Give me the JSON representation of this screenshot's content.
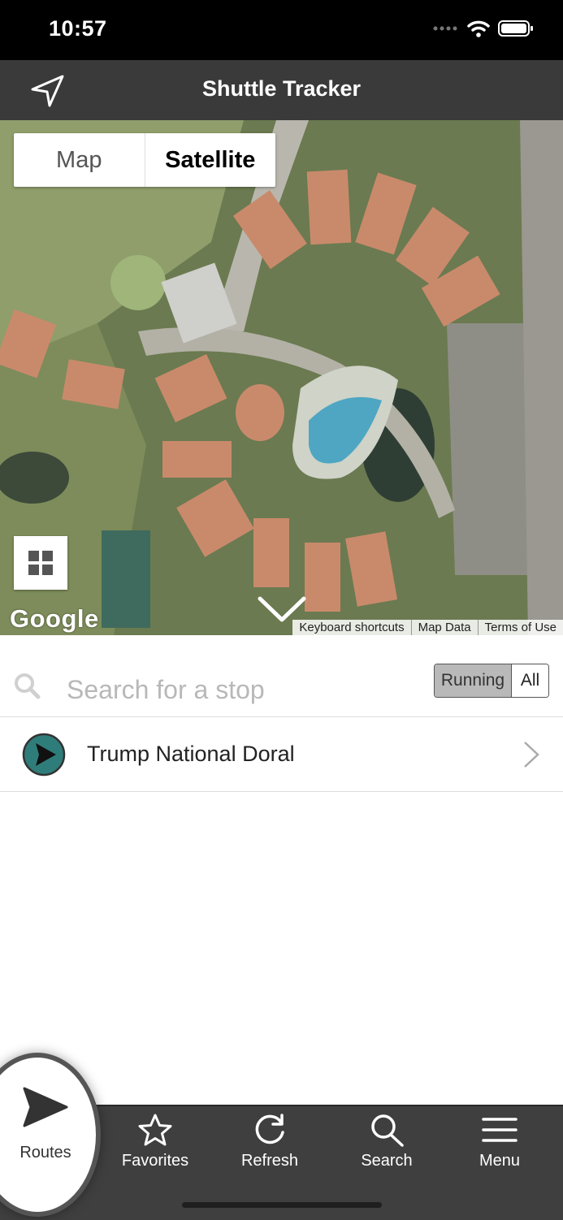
{
  "status_bar": {
    "time": "10:57",
    "signal_icon": "signal-dots-icon",
    "wifi_icon": "wifi-icon",
    "battery_icon": "battery-icon"
  },
  "nav": {
    "title": "Shuttle Tracker",
    "left_icon": "location-arrow-icon"
  },
  "map": {
    "type_toggle": {
      "map_label": "Map",
      "satellite_label": "Satellite",
      "selected": "Satellite"
    },
    "layers_icon": "grid-icon",
    "logo": "Google",
    "footer": {
      "keyboard": "Keyboard shortcuts",
      "data": "Map Data",
      "terms": "Terms of Use"
    },
    "collapse_icon": "chevron-down-icon"
  },
  "search": {
    "placeholder": "Search for a stop",
    "value": "",
    "icon": "search-icon"
  },
  "filter": {
    "running_label": "Running",
    "all_label": "All",
    "selected": "Running"
  },
  "routes": [
    {
      "name": "Trump National Doral",
      "color": "#2f7d7a",
      "icon": "play-circle-icon"
    }
  ],
  "tabs": {
    "routes": {
      "label": "Routes",
      "icon": "play-icon"
    },
    "favorites": {
      "label": "Favorites",
      "icon": "star-icon"
    },
    "refresh": {
      "label": "Refresh",
      "icon": "refresh-icon"
    },
    "search": {
      "label": "Search",
      "icon": "search-icon"
    },
    "menu": {
      "label": "Menu",
      "icon": "hamburger-icon"
    }
  },
  "colors": {
    "nav_bg": "#3a3a3a",
    "tab_bg": "#3f3f3f",
    "route_accent": "#2f7d7a"
  }
}
